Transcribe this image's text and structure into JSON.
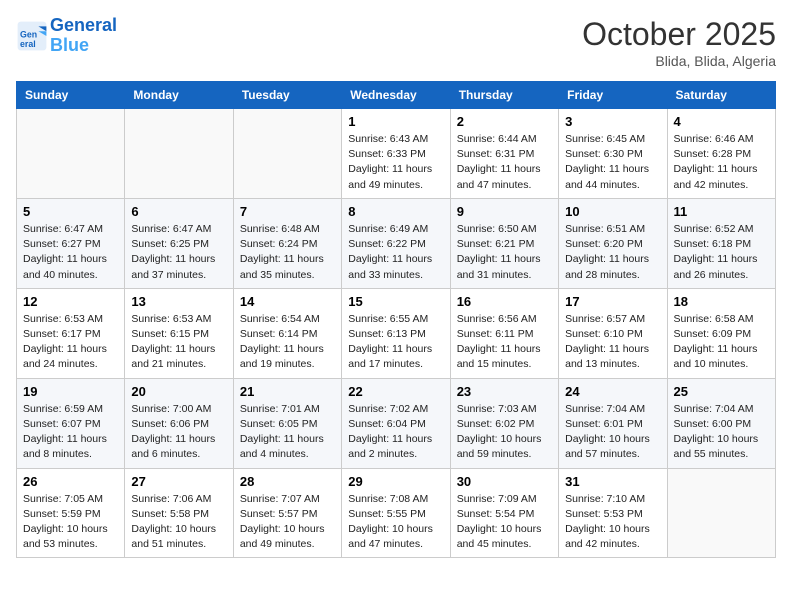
{
  "header": {
    "logo_line1": "General",
    "logo_line2": "Blue",
    "month": "October 2025",
    "location": "Blida, Blida, Algeria"
  },
  "days_of_week": [
    "Sunday",
    "Monday",
    "Tuesday",
    "Wednesday",
    "Thursday",
    "Friday",
    "Saturday"
  ],
  "weeks": [
    [
      {
        "num": "",
        "info": ""
      },
      {
        "num": "",
        "info": ""
      },
      {
        "num": "",
        "info": ""
      },
      {
        "num": "1",
        "info": "Sunrise: 6:43 AM\nSunset: 6:33 PM\nDaylight: 11 hours\nand 49 minutes."
      },
      {
        "num": "2",
        "info": "Sunrise: 6:44 AM\nSunset: 6:31 PM\nDaylight: 11 hours\nand 47 minutes."
      },
      {
        "num": "3",
        "info": "Sunrise: 6:45 AM\nSunset: 6:30 PM\nDaylight: 11 hours\nand 44 minutes."
      },
      {
        "num": "4",
        "info": "Sunrise: 6:46 AM\nSunset: 6:28 PM\nDaylight: 11 hours\nand 42 minutes."
      }
    ],
    [
      {
        "num": "5",
        "info": "Sunrise: 6:47 AM\nSunset: 6:27 PM\nDaylight: 11 hours\nand 40 minutes."
      },
      {
        "num": "6",
        "info": "Sunrise: 6:47 AM\nSunset: 6:25 PM\nDaylight: 11 hours\nand 37 minutes."
      },
      {
        "num": "7",
        "info": "Sunrise: 6:48 AM\nSunset: 6:24 PM\nDaylight: 11 hours\nand 35 minutes."
      },
      {
        "num": "8",
        "info": "Sunrise: 6:49 AM\nSunset: 6:22 PM\nDaylight: 11 hours\nand 33 minutes."
      },
      {
        "num": "9",
        "info": "Sunrise: 6:50 AM\nSunset: 6:21 PM\nDaylight: 11 hours\nand 31 minutes."
      },
      {
        "num": "10",
        "info": "Sunrise: 6:51 AM\nSunset: 6:20 PM\nDaylight: 11 hours\nand 28 minutes."
      },
      {
        "num": "11",
        "info": "Sunrise: 6:52 AM\nSunset: 6:18 PM\nDaylight: 11 hours\nand 26 minutes."
      }
    ],
    [
      {
        "num": "12",
        "info": "Sunrise: 6:53 AM\nSunset: 6:17 PM\nDaylight: 11 hours\nand 24 minutes."
      },
      {
        "num": "13",
        "info": "Sunrise: 6:53 AM\nSunset: 6:15 PM\nDaylight: 11 hours\nand 21 minutes."
      },
      {
        "num": "14",
        "info": "Sunrise: 6:54 AM\nSunset: 6:14 PM\nDaylight: 11 hours\nand 19 minutes."
      },
      {
        "num": "15",
        "info": "Sunrise: 6:55 AM\nSunset: 6:13 PM\nDaylight: 11 hours\nand 17 minutes."
      },
      {
        "num": "16",
        "info": "Sunrise: 6:56 AM\nSunset: 6:11 PM\nDaylight: 11 hours\nand 15 minutes."
      },
      {
        "num": "17",
        "info": "Sunrise: 6:57 AM\nSunset: 6:10 PM\nDaylight: 11 hours\nand 13 minutes."
      },
      {
        "num": "18",
        "info": "Sunrise: 6:58 AM\nSunset: 6:09 PM\nDaylight: 11 hours\nand 10 minutes."
      }
    ],
    [
      {
        "num": "19",
        "info": "Sunrise: 6:59 AM\nSunset: 6:07 PM\nDaylight: 11 hours\nand 8 minutes."
      },
      {
        "num": "20",
        "info": "Sunrise: 7:00 AM\nSunset: 6:06 PM\nDaylight: 11 hours\nand 6 minutes."
      },
      {
        "num": "21",
        "info": "Sunrise: 7:01 AM\nSunset: 6:05 PM\nDaylight: 11 hours\nand 4 minutes."
      },
      {
        "num": "22",
        "info": "Sunrise: 7:02 AM\nSunset: 6:04 PM\nDaylight: 11 hours\nand 2 minutes."
      },
      {
        "num": "23",
        "info": "Sunrise: 7:03 AM\nSunset: 6:02 PM\nDaylight: 10 hours\nand 59 minutes."
      },
      {
        "num": "24",
        "info": "Sunrise: 7:04 AM\nSunset: 6:01 PM\nDaylight: 10 hours\nand 57 minutes."
      },
      {
        "num": "25",
        "info": "Sunrise: 7:04 AM\nSunset: 6:00 PM\nDaylight: 10 hours\nand 55 minutes."
      }
    ],
    [
      {
        "num": "26",
        "info": "Sunrise: 7:05 AM\nSunset: 5:59 PM\nDaylight: 10 hours\nand 53 minutes."
      },
      {
        "num": "27",
        "info": "Sunrise: 7:06 AM\nSunset: 5:58 PM\nDaylight: 10 hours\nand 51 minutes."
      },
      {
        "num": "28",
        "info": "Sunrise: 7:07 AM\nSunset: 5:57 PM\nDaylight: 10 hours\nand 49 minutes."
      },
      {
        "num": "29",
        "info": "Sunrise: 7:08 AM\nSunset: 5:55 PM\nDaylight: 10 hours\nand 47 minutes."
      },
      {
        "num": "30",
        "info": "Sunrise: 7:09 AM\nSunset: 5:54 PM\nDaylight: 10 hours\nand 45 minutes."
      },
      {
        "num": "31",
        "info": "Sunrise: 7:10 AM\nSunset: 5:53 PM\nDaylight: 10 hours\nand 42 minutes."
      },
      {
        "num": "",
        "info": ""
      }
    ]
  ]
}
